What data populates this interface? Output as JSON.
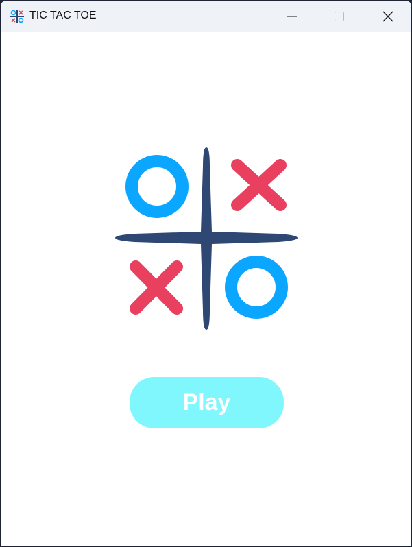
{
  "window": {
    "title": "TIC TAC TOE"
  },
  "main": {
    "play_label": "Play"
  },
  "colors": {
    "o": "#0aa6ff",
    "x": "#e8405e",
    "grid": "#2e4873",
    "button": "#7ff7fd"
  }
}
